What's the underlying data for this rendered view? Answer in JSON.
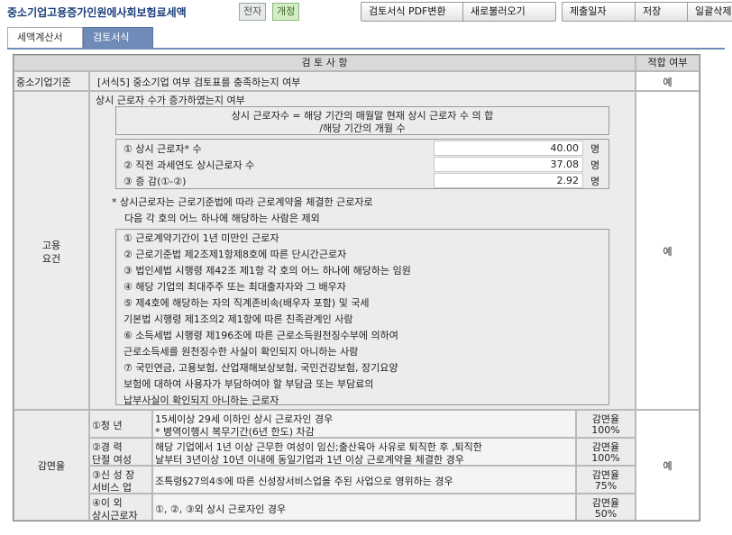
{
  "app": {
    "title": "중소기업고용증가인원에사회보험료세액",
    "pill_a": "전자",
    "pill_b": "개정"
  },
  "toolbar": {
    "pdf": "검토서식 PDF변환",
    "reload": "새로불러오기",
    "submit_date": "제출일자",
    "save": "저장",
    "batch": "일괄삭제"
  },
  "tabs": [
    {
      "label": "세액계산서"
    },
    {
      "label": "검토서식"
    }
  ],
  "table": {
    "header_review": "검 토 사 항",
    "header_fit": "적합 여부",
    "row1": {
      "label": "중소기업기준",
      "text": "[서식5] 중소기업 여부 검토표를 충족하는지 여부",
      "fit": "예"
    },
    "row2": {
      "label_1": "고용",
      "label_2": "요건",
      "title": "상시 근로자 수가 증가하였는지 여부",
      "formula_1": "상시 근로자수 = 해당 기간의 매월말 현재 상시 근로자 수 의 합",
      "formula_2": "/해당 기간의 개월 수",
      "items": [
        {
          "label": "① 상시 근로자* 수",
          "value": "40.00",
          "unit": "명"
        },
        {
          "label": "② 직전 과세연도  상시근로자 수",
          "value": "37.08",
          "unit": "명"
        },
        {
          "label": "③ 증  감(①-②)",
          "value": "2.92",
          "unit": "명"
        }
      ],
      "note_1": "* 상시근로자는 근로기준법에 따라 근로계약을 체결한 근로자로",
      "note_2": "다음 각 호의 어느 하나에 해당하는 사람은 제외",
      "exclusions": [
        "① 근로계약기간이 1년 미만인 근로자",
        "② 근로기준법 제2조제1항제8호에 따른 단시간근로자",
        "③ 법인세법 시행령 제42조 제1항 각 호의 어느 하나에 해당하는 임원",
        "④ 해당 기업의 최대주주 또는 최대출자자와 그 배우자",
        "⑤ 제4호에 해당하는 자의 직계존비속(배우자 포함) 및 국세",
        "   기본법 시행령 제1조의2 제1항에 따른 친족관계인 사람",
        "⑥ 소득세법 시행령 제196조에 따른 근로소득원천징수부에 의하여",
        "   근로소득세를 원천징수한 사실이 확인되지 아니하는 사람",
        "⑦ 국민연금, 고용보험, 산업재해보상보험, 국민건강보험, 장기요양",
        "   보험에 대하여 사용자가 부담하여야 할 부담금 또는 부담료의",
        "   납부사실이 확인되지 아니하는 근로자"
      ],
      "fit": "예"
    },
    "row3": {
      "label": "감면율",
      "fit": "예",
      "sub": [
        {
          "name_1": "①청      년",
          "name_2": "",
          "desc_1": "15세이상 29세 이하인 상시 근로자인 경우",
          "desc_2": " * 병역이행시 복무기간(6년 한도) 차감",
          "rate_1": "감면율",
          "rate_2": "100%"
        },
        {
          "name_1": "②경    력",
          "name_2": "단절  여성",
          "desc_1": "해당 기업에서 1년 이상 근무한 여성이 임신;출산육아 사유로 퇴직한 후 ,퇴직한",
          "desc_2": "날부터 3년이상 10년 이내에 동일기업과 1년 이상 근로계약을 체결한 경우",
          "rate_1": "감면율",
          "rate_2": "100%"
        },
        {
          "name_1": "③신 성 장",
          "name_2": "서비스  업",
          "desc_1": "조특령§27의4⑤에 따른 신성장서비스업을 주된 사업으로 영위하는 경우",
          "desc_2": "",
          "rate_1": "감면율",
          "rate_2": "75%"
        },
        {
          "name_1": "④이    외",
          "name_2": "상시근로자",
          "desc_1": "①, ②, ③외 상시 근로자인 경우",
          "desc_2": "",
          "rate_1": "감면율",
          "rate_2": "50%"
        }
      ]
    }
  }
}
